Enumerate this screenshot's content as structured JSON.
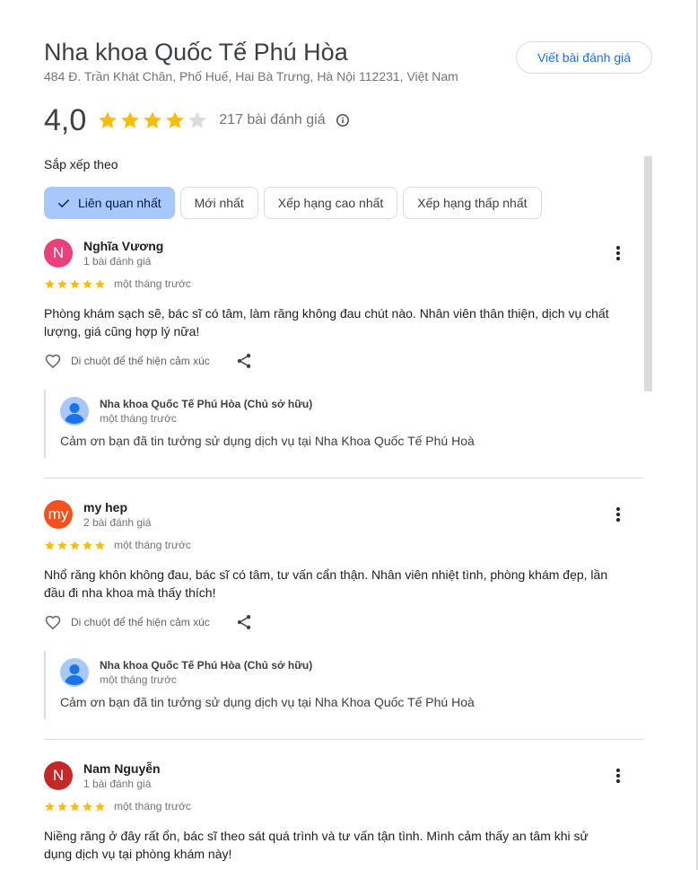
{
  "header": {
    "title": "Nha khoa Quốc Tế Phú Hòa",
    "address": "484 Đ. Trần Khát Chân, Phố Huế, Hai Bà Trưng, Hà Nội 112231, Việt Nam",
    "write_review_label": "Viết bài đánh giá"
  },
  "rating": {
    "value": "4,0",
    "stars": 4,
    "count_label": "217 bài đánh giá"
  },
  "sort": {
    "label": "Sắp xếp theo",
    "options": [
      "Liên quan nhất",
      "Mới nhất",
      "Xếp hạng cao nhất",
      "Xếp hạng thấp nhất"
    ],
    "selected": "Liên quan nhất"
  },
  "colors": {
    "star": "#fbbc04",
    "star_empty": "#dadce0",
    "accent": "#1a73e8",
    "chip_active": "#a8c7fa"
  },
  "reviews": [
    {
      "avatar_letter": "N",
      "avatar_color": "#ec407a",
      "name": "Nghĩa Vương",
      "meta": "1 bài đánh giá",
      "stars": 5,
      "time": "một tháng trước",
      "text": "Phòng khám sạch sẽ, bác sĩ có tâm, làm răng không đau chút nào. Nhân viên thân thiện, dịch vụ chất lượng, giá cũng hợp lý nữa!",
      "react_label": "Di chuột để thể hiện cảm xúc",
      "owner": {
        "name": "Nha khoa Quốc Tế Phú Hòa (Chủ sở hữu)",
        "time": "một tháng trước",
        "text": "Cảm ơn bạn đã tin tưởng sử dụng dịch vụ tại Nha Khoa Quốc Tế Phú Hoà"
      }
    },
    {
      "avatar_letter": "my",
      "avatar_color": "#f4511e",
      "name": "my hep",
      "meta": "2 bài đánh giá",
      "stars": 5,
      "time": "một tháng trước",
      "text": "Nhổ răng khôn không đau, bác sĩ có tâm, tư vấn cẩn thận. Nhân viên nhiệt tình, phòng khám đẹp, lần đầu đi nha khoa mà thấy thích!",
      "react_label": "Di chuột để thể hiện cảm xúc",
      "owner": {
        "name": "Nha khoa Quốc Tế Phú Hòa (Chủ sở hữu)",
        "time": "một tháng trước",
        "text": "Cảm ơn bạn đã tin tưởng sử dụng dịch vụ tại Nha Khoa Quốc Tế Phú Hoà"
      }
    },
    {
      "avatar_letter": "N",
      "avatar_color": "#c62828",
      "name": "Nam Nguyễn",
      "meta": "1 bài đánh giá",
      "stars": 5,
      "time": "một tháng trước",
      "text": "Niềng răng ở đây rất ổn, bác sĩ theo sát quá trình và tư vấn tận tình. Mình cảm thấy an tâm khi sử dụng dịch vụ tại phòng khám này!"
    }
  ]
}
